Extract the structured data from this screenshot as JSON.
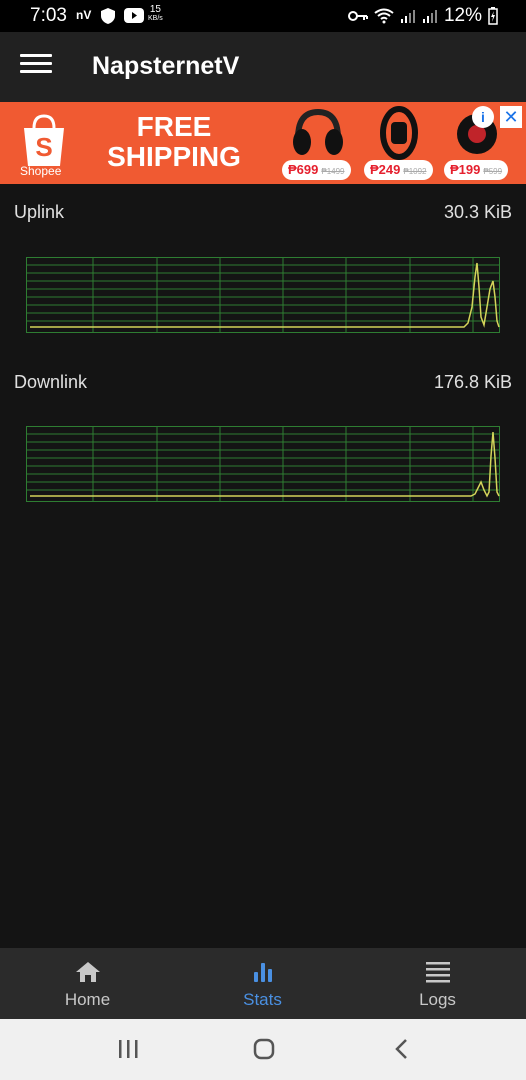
{
  "status_bar": {
    "time": "7:03",
    "nv": "nV",
    "speed_value": "15",
    "speed_unit": "KB/s",
    "battery": "12%"
  },
  "app_bar": {
    "title": "NapsternetV",
    "menu_icon": "hamburger-menu-icon"
  },
  "ad": {
    "brand": "Shopee",
    "headline_1": "FREE",
    "headline_2": "SHIPPING",
    "prices": [
      {
        "price": "₱699",
        "old": "₱1499"
      },
      {
        "price": "₱249",
        "old": "₱1092"
      },
      {
        "price": "₱199",
        "old": "₱599"
      }
    ],
    "info_icon": "info-icon",
    "close_icon": "close-icon"
  },
  "stats": {
    "uplink": {
      "label": "Uplink",
      "value": "30.3 KiB"
    },
    "downlink": {
      "label": "Downlink",
      "value": "176.8 KiB"
    }
  },
  "colors": {
    "graph_grid": "#2e7d32",
    "graph_line": "#d4d45a",
    "nav_active": "#4a90e2",
    "ad_background": "#f05a32"
  },
  "bottom_nav": {
    "items": [
      {
        "label": "Home",
        "icon": "home-icon"
      },
      {
        "label": "Stats",
        "icon": "bar-chart-icon"
      },
      {
        "label": "Logs",
        "icon": "logs-icon"
      }
    ],
    "active": "Stats"
  },
  "system_nav": {
    "recent_icon": "recent-apps-icon",
    "home_icon": "home-circle-icon",
    "back_icon": "back-icon"
  }
}
